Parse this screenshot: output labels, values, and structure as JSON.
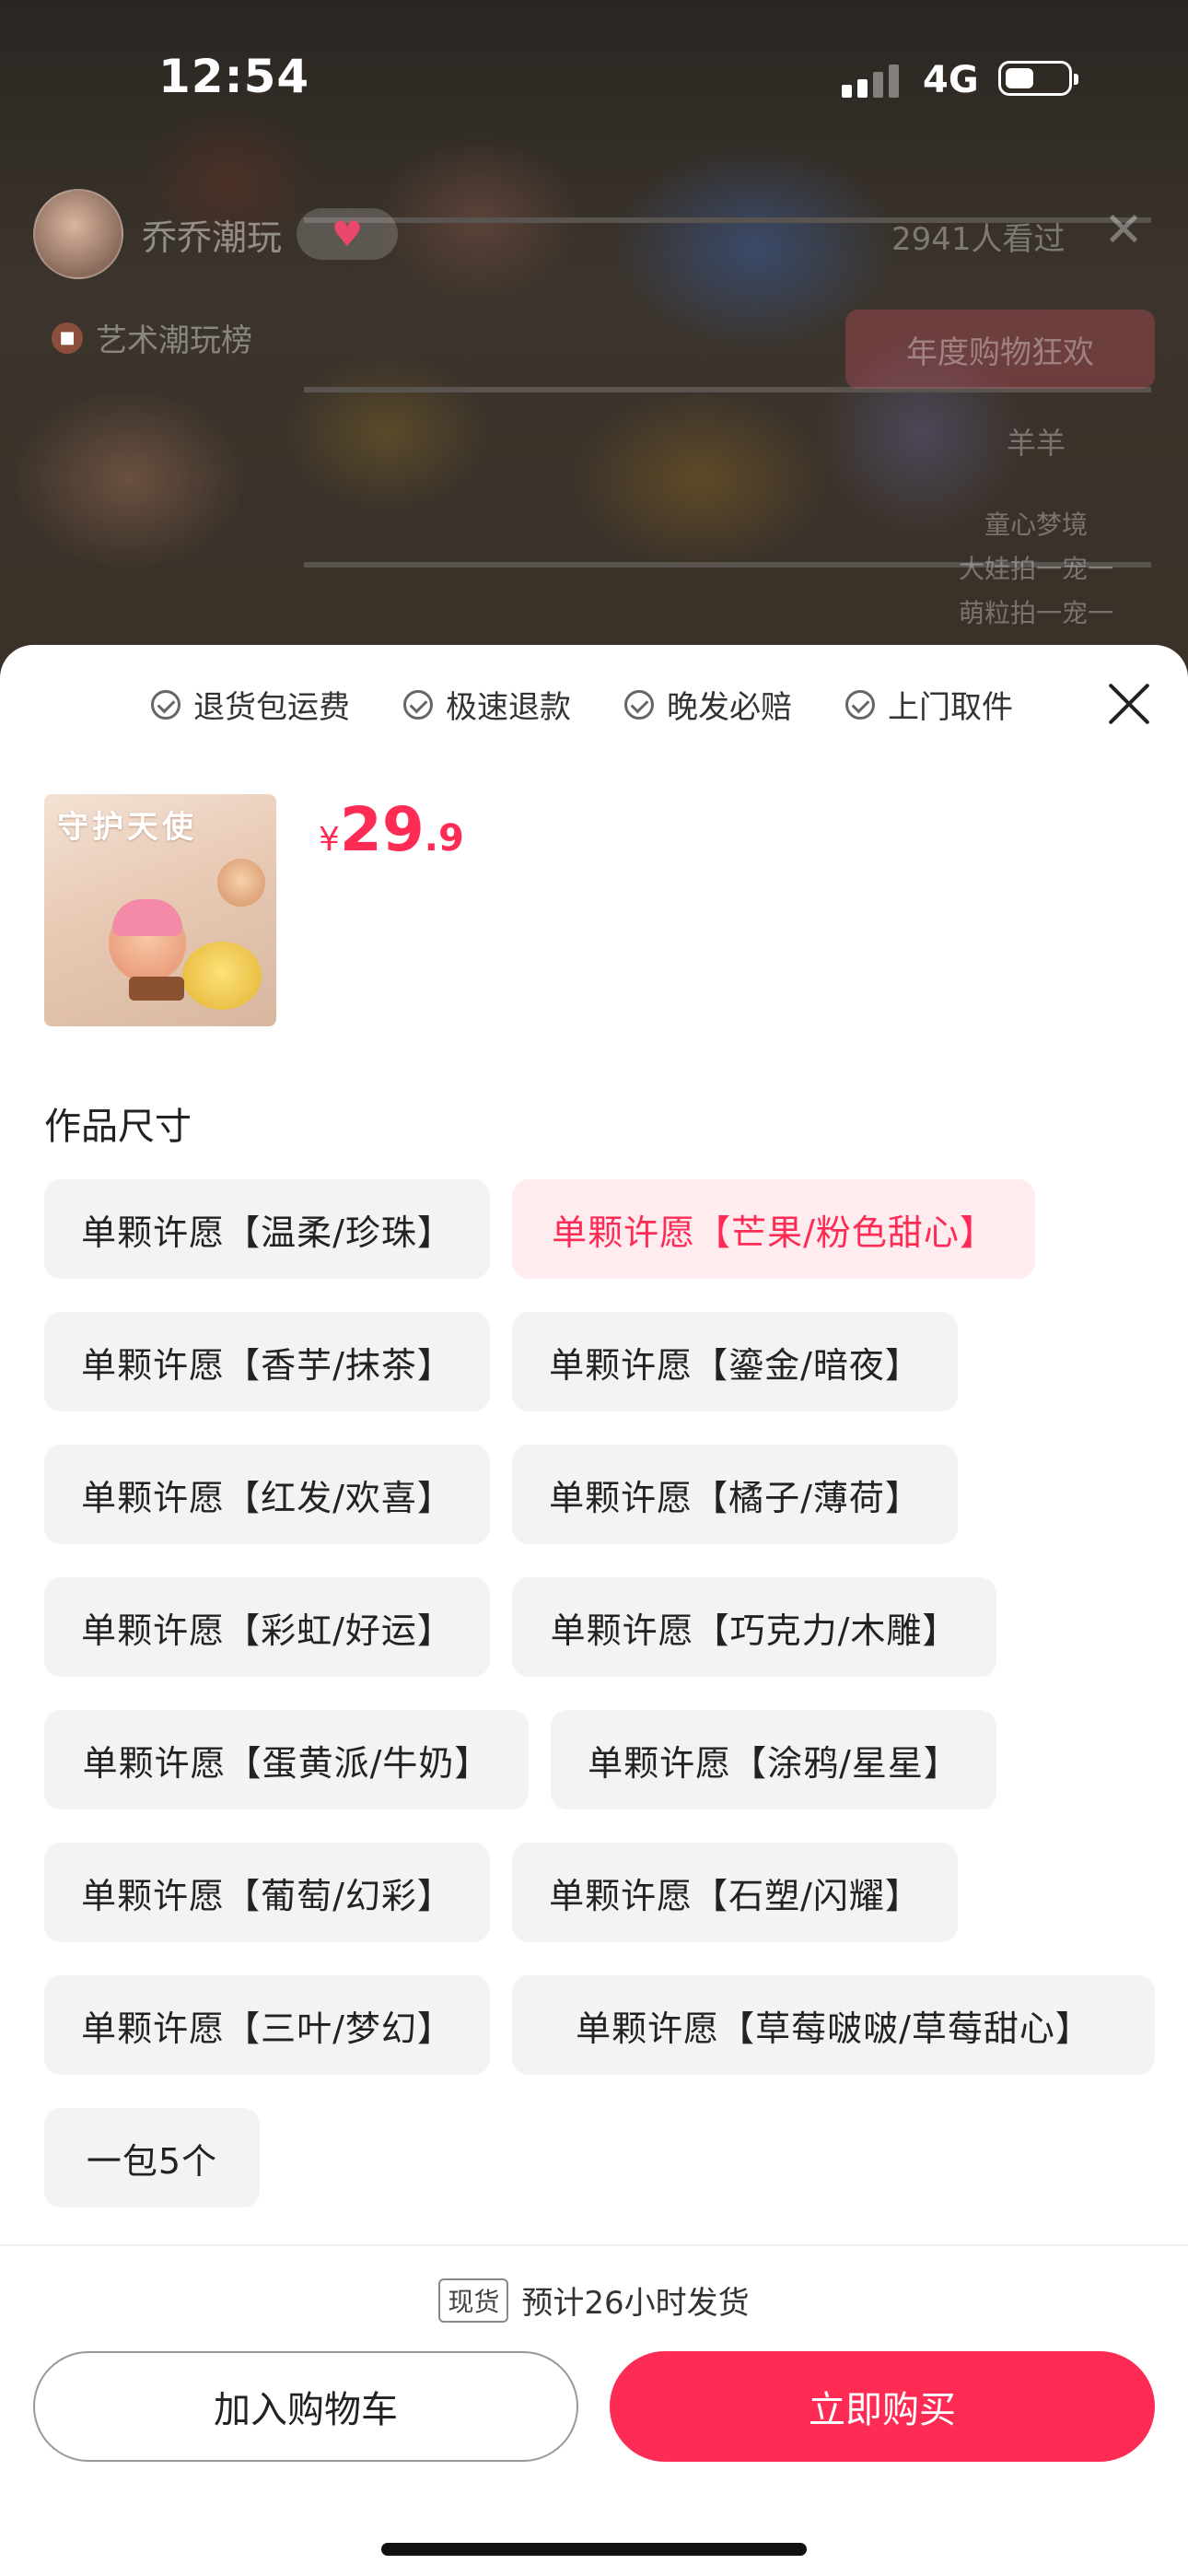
{
  "status_bar": {
    "time": "12:54",
    "network": "4G"
  },
  "stream": {
    "host_name": "乔乔潮玩",
    "follow_icon": "heart-icon",
    "viewers": "2941人看过",
    "rank": "艺术潮玩榜",
    "promo": "年度购物狂欢",
    "side_header": "羊羊",
    "side_items": [
      "童心梦境",
      "大娃拍一宠一",
      "萌粒拍一宠一"
    ]
  },
  "sheet": {
    "guarantees": [
      "退货包运费",
      "极速退款",
      "晚发必赔",
      "上门取件"
    ],
    "product_image_title": "守护天使",
    "price": {
      "currency": "¥",
      "integer": "29",
      "decimal": ".9"
    },
    "section_title": "作品尺寸",
    "options": [
      {
        "label": "单颗许愿【温柔/珍珠】",
        "selected": false
      },
      {
        "label": "单颗许愿【芒果/粉色甜心】",
        "selected": true
      },
      {
        "label": "单颗许愿【香芋/抹茶】",
        "selected": false
      },
      {
        "label": "单颗许愿【鎏金/暗夜】",
        "selected": false
      },
      {
        "label": "单颗许愿【红发/欢喜】",
        "selected": false
      },
      {
        "label": "单颗许愿【橘子/薄荷】",
        "selected": false
      },
      {
        "label": "单颗许愿【彩虹/好运】",
        "selected": false
      },
      {
        "label": "单颗许愿【巧克力/木雕】",
        "selected": false
      },
      {
        "label": "单颗许愿【蛋黄派/牛奶】",
        "selected": false
      },
      {
        "label": "单颗许愿【涂鸦/星星】",
        "selected": false
      },
      {
        "label": "单颗许愿【葡萄/幻彩】",
        "selected": false
      },
      {
        "label": "单颗许愿【石塑/闪耀】",
        "selected": false
      },
      {
        "label": "单颗许愿【三叶/梦幻】",
        "selected": false
      },
      {
        "label": "单颗许愿【草莓啵啵/草莓甜心】",
        "selected": false
      },
      {
        "label": "一包5个",
        "selected": false
      }
    ],
    "stock_badge": "现货",
    "shipping_text": "预计26小时发货",
    "add_to_cart": "加入购物车",
    "buy_now": "立即购买"
  },
  "colors": {
    "accent": "#fe2c55",
    "selected_bg": "#ffecee",
    "option_bg": "#f3f3f5"
  }
}
